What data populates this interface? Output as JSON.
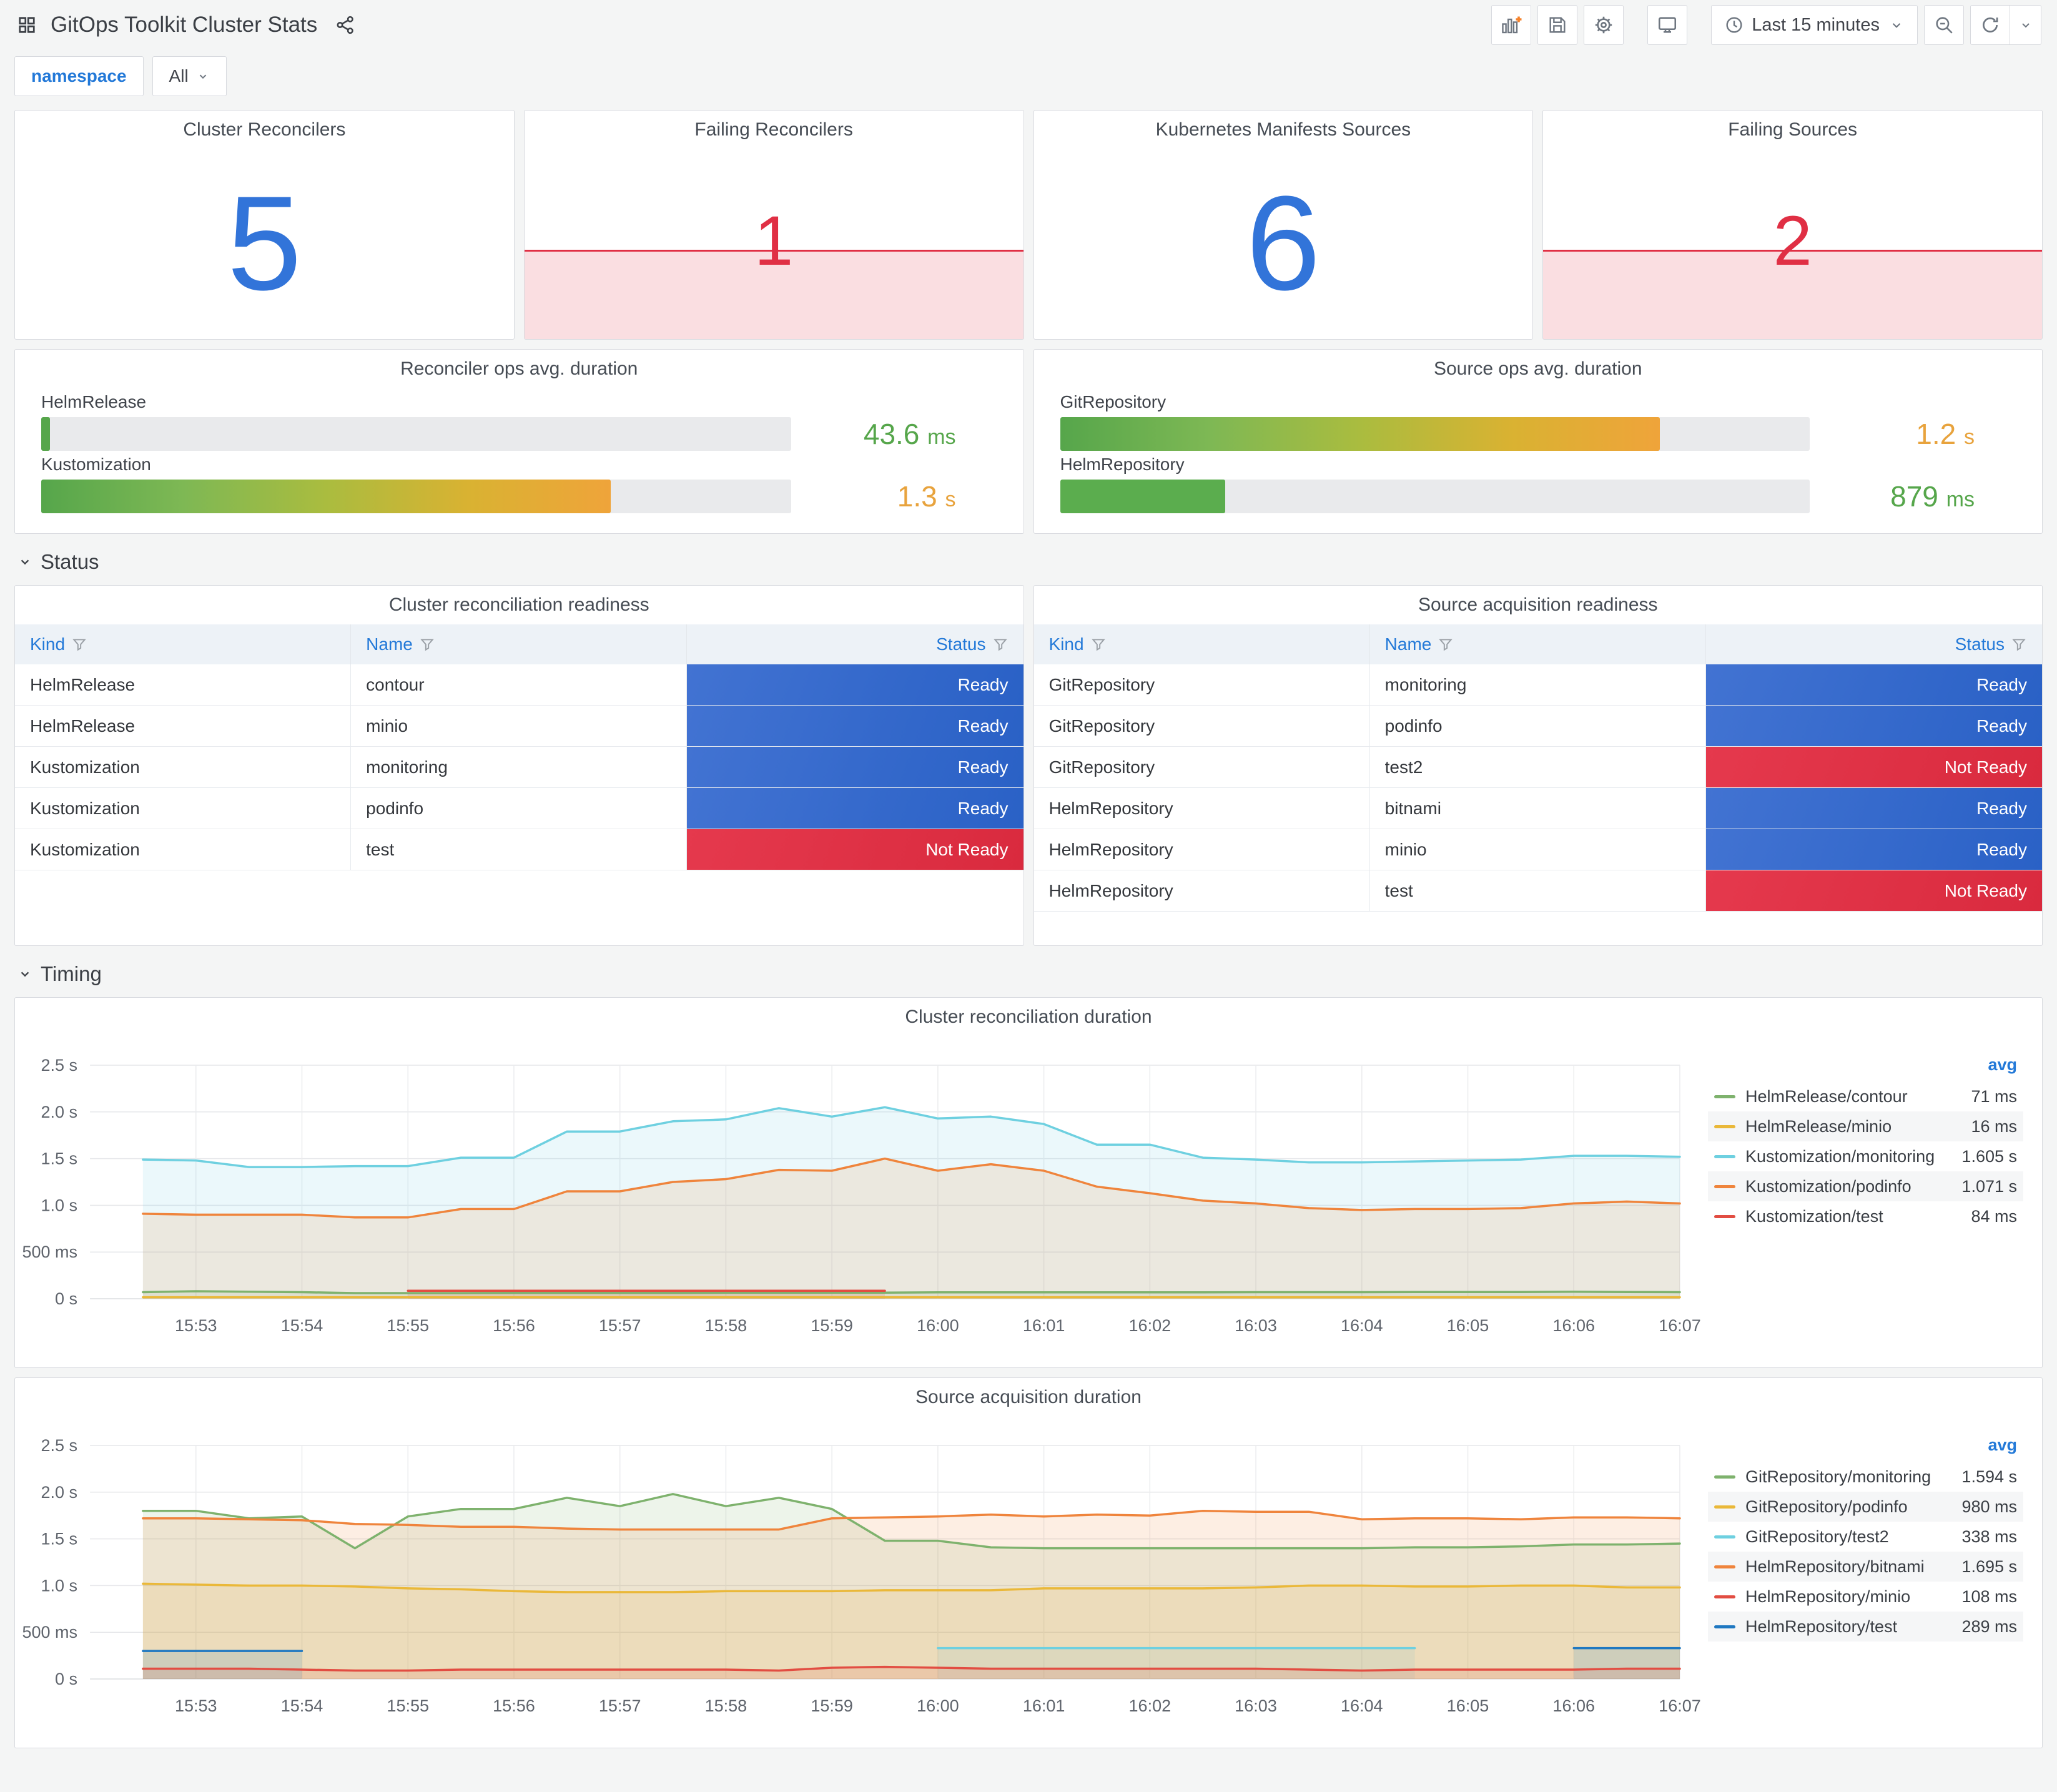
{
  "header": {
    "title": "GitOps Toolkit Cluster Stats",
    "time_range": "Last 15 minutes"
  },
  "toolbar": {
    "buttons": [
      "add-panel",
      "save-dashboard",
      "dashboard-settings",
      "cycle-view-mode",
      "time-range-picker",
      "zoom-out",
      "refresh-dashboard",
      "refresh-interval"
    ]
  },
  "filters": {
    "label": "namespace",
    "value": "All"
  },
  "sections": {
    "status": "Status",
    "timing": "Timing"
  },
  "colors": {
    "stat_blue": "#3274D9",
    "stat_red": "#E02F44",
    "green": "#56A64B",
    "orange_value": "#E8A33D"
  },
  "stats": [
    {
      "title": "Cluster Reconcilers",
      "value": "5",
      "color": "#3274D9",
      "alert": false,
      "trend_fill_pct": 0
    },
    {
      "title": "Failing Reconcilers",
      "value": "1",
      "color": "#E02F44",
      "alert": true,
      "trend_fill_pct": 39
    },
    {
      "title": "Kubernetes Manifests Sources",
      "value": "6",
      "color": "#3274D9",
      "alert": false,
      "trend_fill_pct": 0
    },
    {
      "title": "Failing Sources",
      "value": "2",
      "color": "#E02F44",
      "alert": true,
      "trend_fill_pct": 39
    }
  ],
  "gauges": [
    {
      "title": "Reconciler ops avg. duration",
      "rows": [
        {
          "label": "HelmRelease",
          "value": "43.6",
          "unit": "ms",
          "pct": 1.2,
          "value_color": "#56A64B",
          "bar_colors": [
            "#56A64B"
          ]
        },
        {
          "label": "Kustomization",
          "value": "1.3",
          "unit": "s",
          "pct": 76,
          "value_color": "#E8A33D",
          "bar_colors": [
            "#56A64B",
            "#7EB854",
            "#AABC3F",
            "#D9B232",
            "#EFA43A"
          ]
        }
      ]
    },
    {
      "title": "Source ops avg. duration",
      "rows": [
        {
          "label": "GitRepository",
          "value": "1.2",
          "unit": "s",
          "pct": 80,
          "value_color": "#E8A33D",
          "bar_colors": [
            "#56A64B",
            "#7EB854",
            "#AABC3F",
            "#D9B232",
            "#EFA43A"
          ]
        },
        {
          "label": "HelmRepository",
          "value": "879",
          "unit": "ms",
          "pct": 22,
          "value_color": "#56A64B",
          "bar_colors": [
            "#5BAD4E"
          ]
        }
      ]
    }
  ],
  "status_styles": {
    "Ready": [
      "#4273D2",
      "#2A61C6"
    ],
    "Not Ready": [
      "#E5394D",
      "#D92A3E"
    ]
  },
  "tables": [
    {
      "title": "Cluster reconciliation readiness",
      "columns": [
        "Kind",
        "Name",
        "Status"
      ],
      "rows": [
        [
          "HelmRelease",
          "contour",
          "Ready"
        ],
        [
          "HelmRelease",
          "minio",
          "Ready"
        ],
        [
          "Kustomization",
          "monitoring",
          "Ready"
        ],
        [
          "Kustomization",
          "podinfo",
          "Ready"
        ],
        [
          "Kustomization",
          "test",
          "Not Ready"
        ]
      ]
    },
    {
      "title": "Source acquisition readiness",
      "columns": [
        "Kind",
        "Name",
        "Status"
      ],
      "rows": [
        [
          "GitRepository",
          "monitoring",
          "Ready"
        ],
        [
          "GitRepository",
          "podinfo",
          "Ready"
        ],
        [
          "GitRepository",
          "test2",
          "Not Ready"
        ],
        [
          "HelmRepository",
          "bitnami",
          "Ready"
        ],
        [
          "HelmRepository",
          "minio",
          "Ready"
        ],
        [
          "HelmRepository",
          "test",
          "Not Ready"
        ]
      ]
    }
  ],
  "chart_data": [
    {
      "type": "line",
      "title": "Cluster reconciliation duration",
      "legend_header": "avg",
      "legend_position": "right",
      "grid": true,
      "ylim": [
        0,
        2.5
      ],
      "y_ticks": [
        {
          "v": 0,
          "label": "0 s"
        },
        {
          "v": 0.5,
          "label": "500 ms"
        },
        {
          "v": 1,
          "label": "1.0 s"
        },
        {
          "v": 1.5,
          "label": "1.5 s"
        },
        {
          "v": 2,
          "label": "2.0 s"
        },
        {
          "v": 2.5,
          "label": "2.5 s"
        }
      ],
      "x_ticks": [
        "15:53",
        "15:54",
        "15:55",
        "15:56",
        "15:57",
        "15:58",
        "15:59",
        "16:00",
        "16:01",
        "16:02",
        "16:03",
        "16:04",
        "16:05",
        "16:06",
        "16:07"
      ],
      "t_start": 0.5,
      "t_step": 0.5,
      "t_max": 15,
      "series": [
        {
          "name": "HelmRelease/contour",
          "avg": "71 ms",
          "color": "#7EB26D",
          "values": [
            0.07,
            0.08,
            0.075,
            0.07,
            0.06,
            0.06,
            0.06,
            0.062,
            0.062,
            0.062,
            0.062,
            0.064,
            0.064,
            0.065,
            0.065,
            0.068,
            0.068,
            0.068,
            0.068,
            0.068,
            0.068,
            0.07,
            0.07,
            0.07,
            0.072,
            0.072,
            0.072,
            0.075,
            0.072,
            0.07
          ]
        },
        {
          "name": "HelmRelease/minio",
          "avg": "16 ms",
          "color": "#EAB839",
          "values": [
            0.016,
            0.016,
            0.016,
            0.016,
            0.016,
            0.016,
            0.016,
            0.016,
            0.016,
            0.016,
            0.016,
            0.016,
            0.016,
            0.016,
            0.016,
            0.016,
            0.016,
            0.016,
            0.016,
            0.016,
            0.016,
            0.016,
            0.016,
            0.016,
            0.016,
            0.016,
            0.016,
            0.016,
            0.016,
            0.016
          ]
        },
        {
          "name": "Kustomization/monitoring",
          "avg": "1.605 s",
          "color": "#6ED0E0",
          "values": [
            1.49,
            1.48,
            1.41,
            1.41,
            1.42,
            1.42,
            1.51,
            1.51,
            1.79,
            1.79,
            1.9,
            1.92,
            2.04,
            1.95,
            2.05,
            1.93,
            1.95,
            1.87,
            1.65,
            1.65,
            1.51,
            1.49,
            1.46,
            1.46,
            1.47,
            1.48,
            1.49,
            1.53,
            1.53,
            1.52
          ]
        },
        {
          "name": "Kustomization/podinfo",
          "avg": "1.071 s",
          "color": "#EF843C",
          "values": [
            0.91,
            0.9,
            0.9,
            0.9,
            0.87,
            0.87,
            0.96,
            0.96,
            1.15,
            1.15,
            1.25,
            1.28,
            1.38,
            1.37,
            1.5,
            1.37,
            1.44,
            1.37,
            1.2,
            1.13,
            1.05,
            1.02,
            0.97,
            0.95,
            0.96,
            0.96,
            0.97,
            1.02,
            1.04,
            1.02
          ]
        },
        {
          "name": "Kustomization/test",
          "avg": "84 ms",
          "color": "#E24D42",
          "values": [
            null,
            null,
            null,
            null,
            null,
            0.085,
            0.085,
            0.085,
            0.085,
            0.085,
            0.085,
            0.085,
            0.085,
            0.085,
            0.085,
            null,
            null,
            null,
            null,
            null,
            null,
            null,
            null,
            null,
            null,
            null,
            null,
            null,
            null,
            null
          ]
        }
      ]
    },
    {
      "type": "line",
      "title": "Source acquisition duration",
      "legend_header": "avg",
      "legend_position": "right",
      "grid": true,
      "ylim": [
        0,
        2.5
      ],
      "y_ticks": [
        {
          "v": 0,
          "label": "0 s"
        },
        {
          "v": 0.5,
          "label": "500 ms"
        },
        {
          "v": 1,
          "label": "1.0 s"
        },
        {
          "v": 1.5,
          "label": "1.5 s"
        },
        {
          "v": 2,
          "label": "2.0 s"
        },
        {
          "v": 2.5,
          "label": "2.5 s"
        }
      ],
      "x_ticks": [
        "15:53",
        "15:54",
        "15:55",
        "15:56",
        "15:57",
        "15:58",
        "15:59",
        "16:00",
        "16:01",
        "16:02",
        "16:03",
        "16:04",
        "16:05",
        "16:06",
        "16:07"
      ],
      "t_start": 0.5,
      "t_step": 0.5,
      "t_max": 15,
      "series": [
        {
          "name": "GitRepository/monitoring",
          "avg": "1.594 s",
          "color": "#7EB26D",
          "values": [
            1.8,
            1.8,
            1.72,
            1.74,
            1.4,
            1.74,
            1.82,
            1.82,
            1.94,
            1.85,
            1.98,
            1.85,
            1.94,
            1.82,
            1.48,
            1.48,
            1.41,
            1.4,
            1.4,
            1.4,
            1.4,
            1.4,
            1.4,
            1.4,
            1.41,
            1.41,
            1.42,
            1.44,
            1.44,
            1.45
          ]
        },
        {
          "name": "GitRepository/podinfo",
          "avg": "980 ms",
          "color": "#EAB839",
          "values": [
            1.02,
            1.01,
            1.0,
            1.0,
            0.99,
            0.97,
            0.96,
            0.94,
            0.93,
            0.93,
            0.93,
            0.94,
            0.94,
            0.94,
            0.95,
            0.95,
            0.95,
            0.97,
            0.97,
            0.97,
            0.97,
            0.98,
            1.0,
            1.0,
            0.99,
            0.99,
            1.0,
            1.0,
            0.98,
            0.98
          ]
        },
        {
          "name": "GitRepository/test2",
          "avg": "338 ms",
          "color": "#6ED0E0",
          "values": [
            null,
            null,
            null,
            null,
            null,
            null,
            null,
            null,
            null,
            null,
            null,
            null,
            null,
            null,
            null,
            0.33,
            0.33,
            0.33,
            0.33,
            0.33,
            0.33,
            0.33,
            0.33,
            0.33,
            0.33,
            null,
            null,
            null,
            null,
            null
          ]
        },
        {
          "name": "HelmRepository/bitnami",
          "avg": "1.695 s",
          "color": "#EF843C",
          "values": [
            1.72,
            1.72,
            1.71,
            1.7,
            1.66,
            1.65,
            1.63,
            1.63,
            1.61,
            1.6,
            1.6,
            1.6,
            1.6,
            1.72,
            1.73,
            1.74,
            1.76,
            1.74,
            1.76,
            1.75,
            1.8,
            1.79,
            1.79,
            1.71,
            1.72,
            1.72,
            1.71,
            1.73,
            1.73,
            1.72
          ]
        },
        {
          "name": "HelmRepository/minio",
          "avg": "108 ms",
          "color": "#E24D42",
          "values": [
            0.11,
            0.11,
            0.11,
            0.1,
            0.09,
            0.09,
            0.1,
            0.1,
            0.1,
            0.1,
            0.1,
            0.1,
            0.09,
            0.12,
            0.13,
            0.12,
            0.11,
            0.11,
            0.11,
            0.11,
            0.11,
            0.11,
            0.1,
            0.09,
            0.1,
            0.1,
            0.1,
            0.1,
            0.11,
            0.11
          ]
        },
        {
          "name": "HelmRepository/test",
          "avg": "289 ms",
          "color": "#1F78C1",
          "values": [
            0.3,
            0.3,
            0.3,
            0.3,
            null,
            null,
            null,
            null,
            null,
            null,
            null,
            null,
            null,
            null,
            null,
            null,
            null,
            null,
            null,
            null,
            null,
            null,
            null,
            null,
            null,
            null,
            null,
            0.33,
            0.33,
            0.33
          ]
        }
      ]
    }
  ]
}
